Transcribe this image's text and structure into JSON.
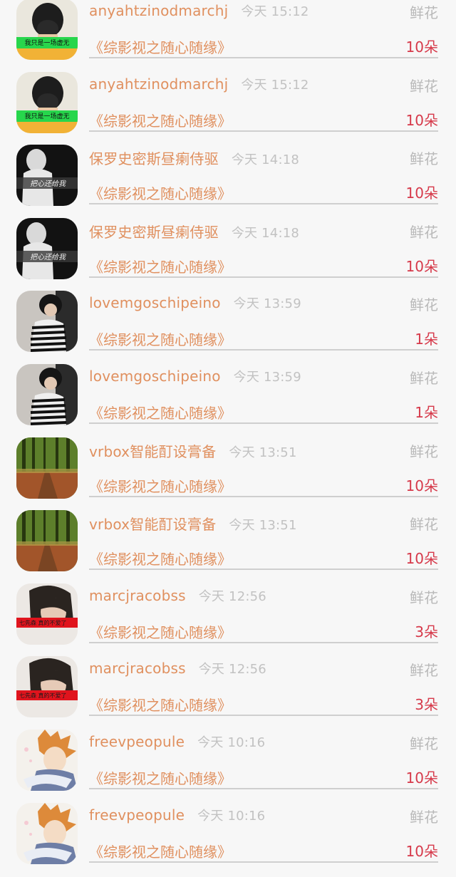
{
  "rows": [
    {
      "avatar": "avatar-girl-green",
      "name": "anyahtzinodmarchj",
      "time": "今天 15:12",
      "gift": "鲜花",
      "drama": "《综影视之随心随缘》",
      "count": "10朵",
      "avatar_caption": "我只是一场虚无"
    },
    {
      "avatar": "avatar-girl-green",
      "name": "anyahtzinodmarchj",
      "time": "今天 15:12",
      "gift": "鲜花",
      "drama": "《综影视之随心随缘》",
      "count": "10朵",
      "avatar_caption": "我只是一场虚无"
    },
    {
      "avatar": "avatar-dark-person",
      "name": "保罗史密斯昼瘌侍驱",
      "time": "今天 14:18",
      "gift": "鲜花",
      "drama": "《综影视之随心随缘》",
      "count": "10朵",
      "avatar_caption": "把心还给我"
    },
    {
      "avatar": "avatar-dark-person",
      "name": "保罗史密斯昼瘌侍驱",
      "time": "今天 14:18",
      "gift": "鲜花",
      "drama": "《综影视之随心随缘》",
      "count": "10朵",
      "avatar_caption": "把心还给我"
    },
    {
      "avatar": "avatar-striped",
      "name": "lovemgoschipeino",
      "time": "今天 13:59",
      "gift": "鲜花",
      "drama": "《综影视之随心随缘》",
      "count": "1朵",
      "avatar_caption": ""
    },
    {
      "avatar": "avatar-striped",
      "name": "lovemgoschipeino",
      "time": "今天 13:59",
      "gift": "鲜花",
      "drama": "《综影视之随心随缘》",
      "count": "1朵",
      "avatar_caption": ""
    },
    {
      "avatar": "avatar-forest",
      "name": "vrbox智能酊设膏备",
      "time": "今天 13:51",
      "gift": "鲜花",
      "drama": "《综影视之随心随缘》",
      "count": "10朵",
      "avatar_caption": ""
    },
    {
      "avatar": "avatar-forest",
      "name": "vrbox智能酊设膏备",
      "time": "今天 13:51",
      "gift": "鲜花",
      "drama": "《综影视之随心随缘》",
      "count": "10朵",
      "avatar_caption": ""
    },
    {
      "avatar": "avatar-girl-red",
      "name": "marcjracobss",
      "time": "今天 12:56",
      "gift": "鲜花",
      "drama": "《综影视之随心随缘》",
      "count": "3朵",
      "avatar_caption": "七先森 真的不爱了"
    },
    {
      "avatar": "avatar-girl-red",
      "name": "marcjracobss",
      "time": "今天 12:56",
      "gift": "鲜花",
      "drama": "《综影视之随心随缘》",
      "count": "3朵",
      "avatar_caption": "七先森 真的不爱了"
    },
    {
      "avatar": "avatar-anime",
      "name": "freevpeopule",
      "time": "今天 10:16",
      "gift": "鲜花",
      "drama": "《综影视之随心随缘》",
      "count": "10朵",
      "avatar_caption": ""
    },
    {
      "avatar": "avatar-anime",
      "name": "freevpeopule",
      "time": "今天 10:16",
      "gift": "鲜花",
      "drama": "《综影视之随心随缘》",
      "count": "10朵",
      "avatar_caption": ""
    }
  ],
  "colors": {
    "name": "#e0905f",
    "time": "#c2c2c2",
    "gift": "#b9b9b9",
    "count": "#d6394a",
    "background": "#f7f7f7"
  }
}
